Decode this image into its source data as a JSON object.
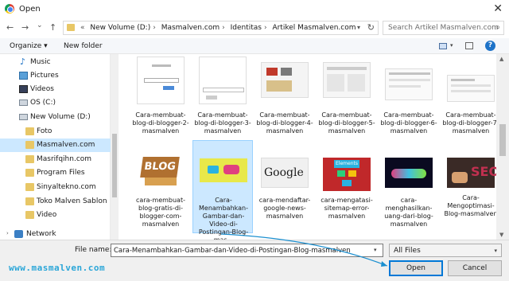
{
  "window": {
    "title": "Open",
    "close_label": "✕"
  },
  "nav": {
    "back": "←",
    "forward": "→",
    "recent": "⌄",
    "up": "↑"
  },
  "address": {
    "breadcrumbs": [
      "New Volume (D:)",
      "Masmalven.com",
      "Identitas",
      "Artikel Masmalven.com"
    ],
    "overflow": "«"
  },
  "search": {
    "placeholder": "Search Artikel Masmalven.com"
  },
  "toolbar": {
    "organize": "Organize ▾",
    "new_folder": "New folder",
    "help": "?"
  },
  "sidebar": {
    "items": [
      {
        "label": "Music",
        "icon": "music-icon"
      },
      {
        "label": "Pictures",
        "icon": "pictures-icon"
      },
      {
        "label": "Videos",
        "icon": "videos-icon"
      },
      {
        "label": "OS (C:)",
        "icon": "drive-icon"
      },
      {
        "label": "New Volume (D:)",
        "icon": "drive-icon"
      },
      {
        "label": "Foto",
        "icon": "folder-icon"
      },
      {
        "label": "Masmalven.com",
        "icon": "folder-icon",
        "selected": true
      },
      {
        "label": "Masrifqihn.com",
        "icon": "folder-icon"
      },
      {
        "label": "Program Files",
        "icon": "folder-icon"
      },
      {
        "label": "Sinyaltekno.com",
        "icon": "folder-icon"
      },
      {
        "label": "Toko Malven Sablon",
        "icon": "folder-icon"
      },
      {
        "label": "Video",
        "icon": "folder-icon"
      },
      {
        "label": "Network",
        "icon": "network-icon"
      }
    ]
  },
  "files": [
    {
      "name": "Cara-membuat-blog-di-blogger-2-masmalven"
    },
    {
      "name": "Cara-membuat-blog-di-blogger-3-masmalven"
    },
    {
      "name": "Cara-membuat-blog-di-blogger-4-masmalven"
    },
    {
      "name": "Cara-membuat-blog-di-blogger-5-masmalven"
    },
    {
      "name": "Cara-membuat-blog-di-blogger-6-masmalven"
    },
    {
      "name": "Cara-membuat-blog-di-blogger-7-masmalven"
    },
    {
      "name": "cara-membuat-blog-gratis-di-blogger-com-masmalven"
    },
    {
      "name": "Cara-Menambahkan-Gambar-dan-Video-di-Postingan-Blog-mas...",
      "selected": true
    },
    {
      "name": "cara-mendaftar-google-news-masmalven"
    },
    {
      "name": "cara-mengatasi-sitemap-error-masmalven"
    },
    {
      "name": "cara-menghasilkan-uang-dari-blog-masmalven"
    },
    {
      "name": "Cara-Mengoptimasi-Blog-masmalven"
    }
  ],
  "bottom": {
    "file_name_label": "File name:",
    "file_name_value": "Cara-Menambahkan-Gambar-dan-Video-di-Postingan-Blog-masmalven",
    "file_type": "All Files",
    "open_button": "Open",
    "cancel_button": "Cancel"
  },
  "thumb_text": {
    "elements": "Elements",
    "google": "Google",
    "blog": "BLOG",
    "seo": "SEO"
  },
  "watermark": "www.masmalven.com",
  "colors": {
    "accent": "#0078d7",
    "selection": "#cce8ff",
    "watermark": "#2aa6d8"
  }
}
